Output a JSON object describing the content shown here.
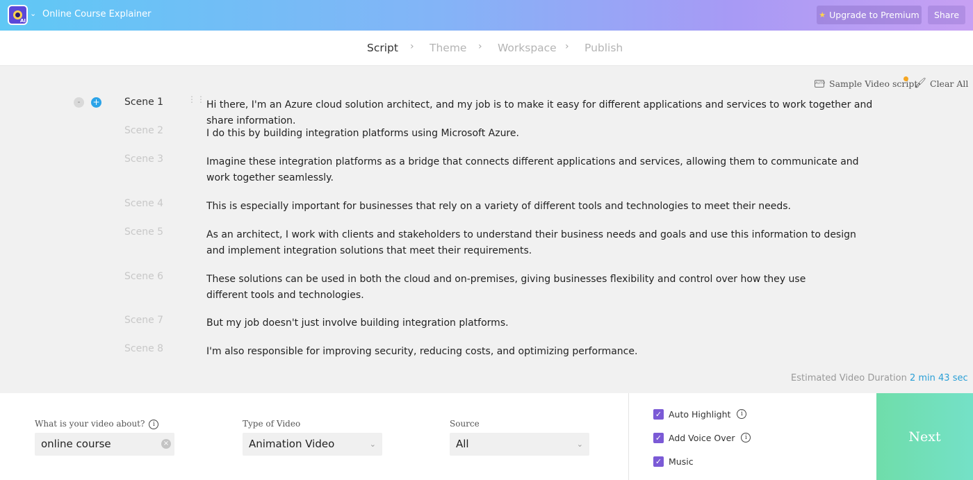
{
  "app": {
    "title": "Online Course Explainer",
    "upgrade_label": "Upgrade to Premium",
    "share_label": "Share",
    "logo_badge": "AI"
  },
  "steps": [
    "Script",
    "Theme",
    "Workspace",
    "Publish"
  ],
  "tools": {
    "sample_label": "Sample Video script",
    "clear_label": "Clear All"
  },
  "scenes": [
    {
      "label": "Scene 1",
      "text": "Hi there, I'm an Azure cloud solution architect, and my job is to make it easy for different applications and services to work together and share information."
    },
    {
      "label": "Scene 2",
      "text": "I do this by building integration platforms using Microsoft Azure."
    },
    {
      "label": "Scene 3",
      "text": "Imagine these integration platforms as a bridge that connects different applications and services, allowing them to communicate and work together seamlessly."
    },
    {
      "label": "Scene 4",
      "text": "This is especially important for businesses that rely on a variety of different tools and technologies to meet their needs."
    },
    {
      "label": "Scene 5",
      "text": "As an architect, I work with clients and stakeholders to understand their business needs and goals and use this information to design and implement integration solutions that meet their requirements."
    },
    {
      "label": "Scene 6",
      "text": "These solutions can be used in both the cloud and on-premises, giving businesses flexibility and control over how they use different tools and technologies."
    },
    {
      "label": "Scene 7",
      "text": "But my job doesn't just involve building integration platforms."
    },
    {
      "label": "Scene 8",
      "text": "I'm also responsible for improving security, reducing costs, and optimizing performance."
    }
  ],
  "duration": {
    "label": "Estimated Video Duration",
    "value": "2 min 43 sec"
  },
  "form": {
    "about_label": "What is your video about?",
    "about_value": "online course",
    "type_label": "Type of Video",
    "type_value": "Animation Video",
    "source_label": "Source",
    "source_value": "All"
  },
  "options": {
    "auto_highlight": "Auto Highlight",
    "voice_over": "Add Voice Over",
    "music": "Music"
  },
  "next_label": "Next",
  "colors": {
    "accent": "#7b5ad6",
    "link": "#2a9fd6",
    "next": "#6fddaa",
    "badge": "#f5a623"
  }
}
